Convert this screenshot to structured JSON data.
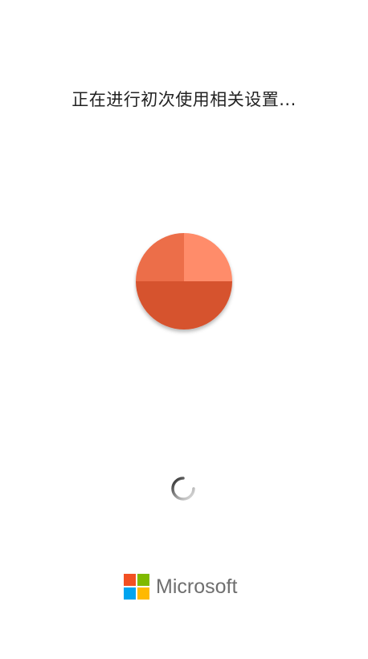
{
  "status": {
    "message": "正在进行初次使用相关设置..."
  },
  "app_logo": {
    "icon": "office-pie-logo-icon",
    "colors": {
      "top_left": "#EC6E4A",
      "top_right": "#FF8C6B",
      "bottom": "#D6522F"
    }
  },
  "spinner": {
    "icon": "loading-spinner-icon",
    "color": "#555555"
  },
  "brand": {
    "name": "Microsoft",
    "logo_colors": {
      "red": "#F25022",
      "green": "#7FBA00",
      "blue": "#00A4EF",
      "yellow": "#FFB900"
    }
  }
}
